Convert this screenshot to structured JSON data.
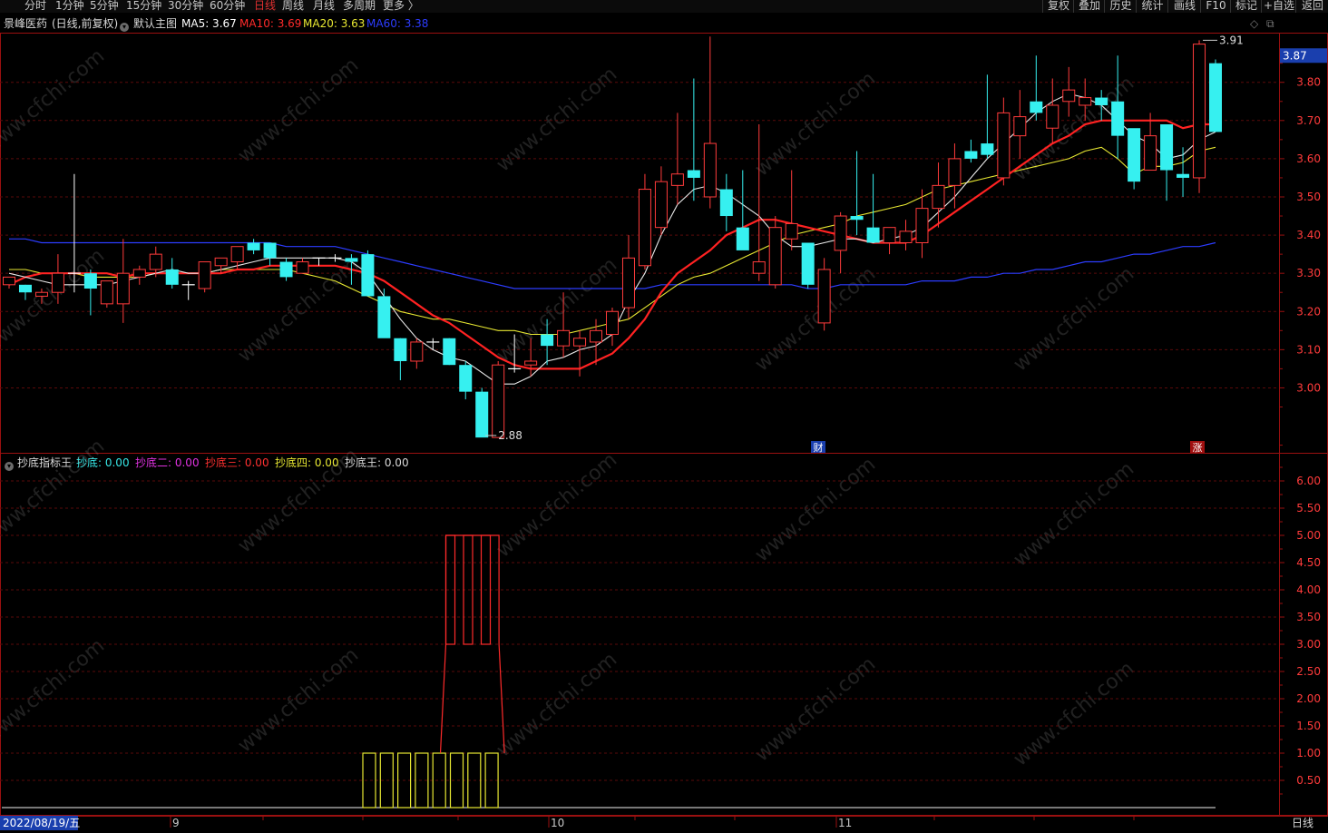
{
  "toolbar": {
    "left_items": [
      "分时",
      "1分钟",
      "5分钟",
      "15分钟",
      "30分钟",
      "60分钟",
      "日线",
      "周线",
      "月线",
      "多周期",
      "更多 〉"
    ],
    "active_item": "日线",
    "right_items": [
      "复权",
      "叠加",
      "历史",
      "统计",
      "画线",
      "F10",
      "标记",
      "+自选",
      "返回"
    ]
  },
  "main_header": {
    "stock_name": "景峰医药",
    "mode": "(日线,前复权)",
    "template_icon": "chevron-down-icon",
    "template": "默认主图",
    "ma": [
      {
        "label": "MA5",
        "value": "3.67",
        "color": "#ffffff"
      },
      {
        "label": "MA10",
        "value": "3.69",
        "color": "#ff2a2a"
      },
      {
        "label": "MA20",
        "value": "3.63",
        "color": "#e8e832"
      },
      {
        "label": "MA60",
        "value": "3.38",
        "color": "#2c3cff"
      }
    ],
    "corner_icons": [
      "diamond-icon",
      "restore-window-icon"
    ]
  },
  "indicator_header": {
    "icon": "chevron-down-icon",
    "name": "抄底指标王",
    "fields": [
      {
        "label": "抄底",
        "value": "0.00",
        "color": "#36e6e6"
      },
      {
        "label": "抄底二",
        "value": "0.00",
        "color": "#e032e0"
      },
      {
        "label": "抄底三",
        "value": "0.00",
        "color": "#ff3030"
      },
      {
        "label": "抄底四",
        "value": "0.00",
        "color": "#e8e832"
      },
      {
        "label": "抄底王",
        "value": "0.00",
        "color": "#d8d8d8"
      }
    ]
  },
  "colors": {
    "up": "#ff3b3b",
    "down": "#36f0f0",
    "ma5": "#e8e8e8",
    "ma10": "#ff2222",
    "ma20": "#e8e832",
    "ma60": "#2c3cff",
    "grid": "#5a0a0a",
    "border": "#9a1010",
    "axis_text": "#ff3b3b"
  },
  "price_axis": {
    "ticks": [
      "3.80",
      "3.70",
      "3.60",
      "3.50",
      "3.40",
      "3.30",
      "3.20",
      "3.10",
      "3.00"
    ],
    "current_price": "3.87"
  },
  "indicator_axis": {
    "ticks": [
      "6.00",
      "5.50",
      "5.00",
      "4.50",
      "4.00",
      "3.50",
      "3.00",
      "2.50",
      "2.00",
      "1.50",
      "1.00",
      "0.50"
    ]
  },
  "annotations": {
    "high_label": "3.91",
    "low_label": "2.88",
    "finance_marker": "财",
    "rise_marker": "涨"
  },
  "date_axis": {
    "first_date": "2022/08/19/五",
    "month_labels": [
      "9",
      "10",
      "11"
    ],
    "period": "日线"
  },
  "watermark": "www.cfchi.com",
  "chart_data": {
    "type": "candlestick",
    "price_range": [
      2.83,
      3.93
    ],
    "candles": [
      [
        3.27,
        3.29,
        3.26,
        3.29
      ],
      [
        3.27,
        3.27,
        3.23,
        3.25
      ],
      [
        3.24,
        3.26,
        3.22,
        3.25
      ],
      [
        3.25,
        3.35,
        3.22,
        3.3
      ],
      [
        3.3,
        3.56,
        3.25,
        3.3
      ],
      [
        3.3,
        3.31,
        3.19,
        3.26
      ],
      [
        3.22,
        3.28,
        3.21,
        3.28
      ],
      [
        3.22,
        3.39,
        3.17,
        3.3
      ],
      [
        3.29,
        3.32,
        3.27,
        3.31
      ],
      [
        3.31,
        3.37,
        3.29,
        3.35
      ],
      [
        3.31,
        3.34,
        3.26,
        3.27
      ],
      [
        3.27,
        3.28,
        3.23,
        3.27
      ],
      [
        3.26,
        3.31,
        3.25,
        3.33
      ],
      [
        3.32,
        3.34,
        3.3,
        3.34
      ],
      [
        3.33,
        3.37,
        3.31,
        3.37
      ],
      [
        3.38,
        3.39,
        3.35,
        3.36
      ],
      [
        3.38,
        3.38,
        3.32,
        3.34
      ],
      [
        3.33,
        3.34,
        3.28,
        3.29
      ],
      [
        3.3,
        3.34,
        3.3,
        3.33
      ],
      [
        3.34,
        3.34,
        3.32,
        3.34
      ],
      [
        3.34,
        3.35,
        3.33,
        3.34
      ],
      [
        3.34,
        3.35,
        3.27,
        3.33
      ],
      [
        3.35,
        3.36,
        3.3,
        3.24
      ],
      [
        3.24,
        3.26,
        3.14,
        3.13
      ],
      [
        3.13,
        3.13,
        3.02,
        3.07
      ],
      [
        3.07,
        3.13,
        3.05,
        3.12
      ],
      [
        3.12,
        3.13,
        3.1,
        3.12
      ],
      [
        3.13,
        3.13,
        3.06,
        3.06
      ],
      [
        3.06,
        3.07,
        2.97,
        2.99
      ],
      [
        2.99,
        3.0,
        2.88,
        2.87
      ],
      [
        2.87,
        3.07,
        2.88,
        3.06
      ],
      [
        3.05,
        3.14,
        3.04,
        3.05
      ],
      [
        3.06,
        3.13,
        3.03,
        3.07
      ],
      [
        3.14,
        3.18,
        3.06,
        3.11
      ],
      [
        3.11,
        3.25,
        3.08,
        3.15
      ],
      [
        3.11,
        3.15,
        3.03,
        3.13
      ],
      [
        3.12,
        3.18,
        3.06,
        3.15
      ],
      [
        3.14,
        3.21,
        3.11,
        3.2
      ],
      [
        3.21,
        3.4,
        3.18,
        3.34
      ],
      [
        3.32,
        3.56,
        3.31,
        3.52
      ],
      [
        3.42,
        3.58,
        3.4,
        3.54
      ],
      [
        3.53,
        3.72,
        3.48,
        3.56
      ],
      [
        3.57,
        3.81,
        3.49,
        3.55
      ],
      [
        3.5,
        3.92,
        3.47,
        3.64
      ],
      [
        3.52,
        3.56,
        3.41,
        3.45
      ],
      [
        3.42,
        3.57,
        3.37,
        3.36
      ],
      [
        3.3,
        3.69,
        3.28,
        3.33
      ],
      [
        3.27,
        3.45,
        3.26,
        3.42
      ],
      [
        3.39,
        3.57,
        3.36,
        3.43
      ],
      [
        3.38,
        3.36,
        3.26,
        3.27
      ],
      [
        3.17,
        3.34,
        3.15,
        3.31
      ],
      [
        3.36,
        3.46,
        3.3,
        3.45
      ],
      [
        3.45,
        3.62,
        3.4,
        3.44
      ],
      [
        3.42,
        3.56,
        3.38,
        3.38
      ],
      [
        3.38,
        3.42,
        3.35,
        3.42
      ],
      [
        3.38,
        3.44,
        3.36,
        3.41
      ],
      [
        3.38,
        3.52,
        3.34,
        3.47
      ],
      [
        3.47,
        3.59,
        3.42,
        3.53
      ],
      [
        3.53,
        3.64,
        3.47,
        3.6
      ],
      [
        3.62,
        3.65,
        3.59,
        3.6
      ],
      [
        3.64,
        3.82,
        3.6,
        3.61
      ],
      [
        3.55,
        3.76,
        3.53,
        3.72
      ],
      [
        3.66,
        3.78,
        3.6,
        3.71
      ],
      [
        3.75,
        3.87,
        3.7,
        3.72
      ],
      [
        3.68,
        3.81,
        3.64,
        3.74
      ],
      [
        3.75,
        3.84,
        3.71,
        3.78
      ],
      [
        3.74,
        3.81,
        3.7,
        3.76
      ],
      [
        3.76,
        3.78,
        3.7,
        3.74
      ],
      [
        3.75,
        3.87,
        3.6,
        3.66
      ],
      [
        3.68,
        3.67,
        3.52,
        3.54
      ],
      [
        3.57,
        3.72,
        3.6,
        3.66
      ],
      [
        3.69,
        3.68,
        3.49,
        3.57
      ],
      [
        3.56,
        3.63,
        3.5,
        3.55
      ],
      [
        3.55,
        3.91,
        3.51,
        3.9
      ],
      [
        3.85,
        3.86,
        3.68,
        3.67
      ]
    ],
    "ma5": [
      3.3,
      3.29,
      3.28,
      3.27,
      3.27,
      3.27,
      3.27,
      3.28,
      3.29,
      3.3,
      3.31,
      3.3,
      3.3,
      3.31,
      3.32,
      3.33,
      3.34,
      3.34,
      3.34,
      3.34,
      3.34,
      3.33,
      3.3,
      3.24,
      3.18,
      3.13,
      3.1,
      3.08,
      3.07,
      3.04,
      3.01,
      3.01,
      3.03,
      3.07,
      3.08,
      3.1,
      3.11,
      3.14,
      3.23,
      3.3,
      3.4,
      3.48,
      3.52,
      3.53,
      3.51,
      3.48,
      3.45,
      3.4,
      3.37,
      3.37,
      3.38,
      3.39,
      3.39,
      3.38,
      3.39,
      3.4,
      3.42,
      3.46,
      3.5,
      3.55,
      3.6,
      3.64,
      3.68,
      3.72,
      3.75,
      3.77,
      3.76,
      3.74,
      3.7,
      3.66,
      3.64,
      3.6,
      3.61,
      3.65,
      3.67
    ],
    "ma10": [
      3.27,
      3.29,
      3.3,
      3.3,
      3.3,
      3.3,
      3.3,
      3.29,
      3.3,
      3.3,
      3.3,
      3.3,
      3.3,
      3.3,
      3.31,
      3.31,
      3.32,
      3.32,
      3.32,
      3.32,
      3.32,
      3.31,
      3.3,
      3.28,
      3.25,
      3.22,
      3.19,
      3.17,
      3.14,
      3.11,
      3.08,
      3.06,
      3.05,
      3.05,
      3.05,
      3.05,
      3.07,
      3.09,
      3.13,
      3.18,
      3.25,
      3.3,
      3.33,
      3.36,
      3.4,
      3.42,
      3.44,
      3.44,
      3.43,
      3.42,
      3.41,
      3.4,
      3.39,
      3.38,
      3.38,
      3.38,
      3.4,
      3.43,
      3.46,
      3.49,
      3.52,
      3.55,
      3.58,
      3.61,
      3.64,
      3.66,
      3.69,
      3.7,
      3.7,
      3.7,
      3.7,
      3.7,
      3.68,
      3.69,
      3.69
    ],
    "ma20": [
      3.31,
      3.31,
      3.3,
      3.3,
      3.3,
      3.29,
      3.29,
      3.29,
      3.29,
      3.3,
      3.3,
      3.3,
      3.3,
      3.31,
      3.31,
      3.31,
      3.31,
      3.31,
      3.3,
      3.29,
      3.28,
      3.26,
      3.24,
      3.22,
      3.2,
      3.19,
      3.18,
      3.18,
      3.17,
      3.16,
      3.15,
      3.15,
      3.14,
      3.14,
      3.14,
      3.15,
      3.16,
      3.17,
      3.18,
      3.21,
      3.24,
      3.27,
      3.29,
      3.3,
      3.32,
      3.34,
      3.36,
      3.38,
      3.4,
      3.41,
      3.42,
      3.43,
      3.45,
      3.46,
      3.47,
      3.48,
      3.5,
      3.52,
      3.53,
      3.54,
      3.55,
      3.56,
      3.57,
      3.58,
      3.59,
      3.6,
      3.62,
      3.63,
      3.6,
      3.56,
      3.58,
      3.58,
      3.59,
      3.62,
      3.63
    ],
    "ma60": [
      3.39,
      3.39,
      3.38,
      3.38,
      3.38,
      3.38,
      3.38,
      3.38,
      3.38,
      3.38,
      3.38,
      3.38,
      3.38,
      3.38,
      3.38,
      3.38,
      3.38,
      3.37,
      3.37,
      3.37,
      3.37,
      3.36,
      3.35,
      3.34,
      3.33,
      3.32,
      3.31,
      3.3,
      3.29,
      3.28,
      3.27,
      3.26,
      3.26,
      3.26,
      3.26,
      3.26,
      3.26,
      3.26,
      3.26,
      3.26,
      3.27,
      3.27,
      3.27,
      3.27,
      3.27,
      3.27,
      3.27,
      3.27,
      3.27,
      3.26,
      3.26,
      3.27,
      3.27,
      3.27,
      3.27,
      3.27,
      3.28,
      3.28,
      3.28,
      3.29,
      3.29,
      3.3,
      3.3,
      3.31,
      3.31,
      3.32,
      3.33,
      3.33,
      3.34,
      3.35,
      3.35,
      3.36,
      3.37,
      3.37,
      3.38
    ],
    "indicator": {
      "range": [
        0,
        6.5
      ],
      "bar_series_1": {
        "indices": [
          20,
          21,
          22,
          23,
          24,
          25,
          26,
          27
        ],
        "values": [
          1,
          1,
          1,
          1,
          1,
          1,
          1,
          1
        ]
      },
      "bar_series_2": {
        "indices": [
          25,
          26,
          27
        ],
        "values": [
          5,
          5,
          5
        ]
      },
      "bar_series_2_floor": 3,
      "baseline": 0
    }
  }
}
